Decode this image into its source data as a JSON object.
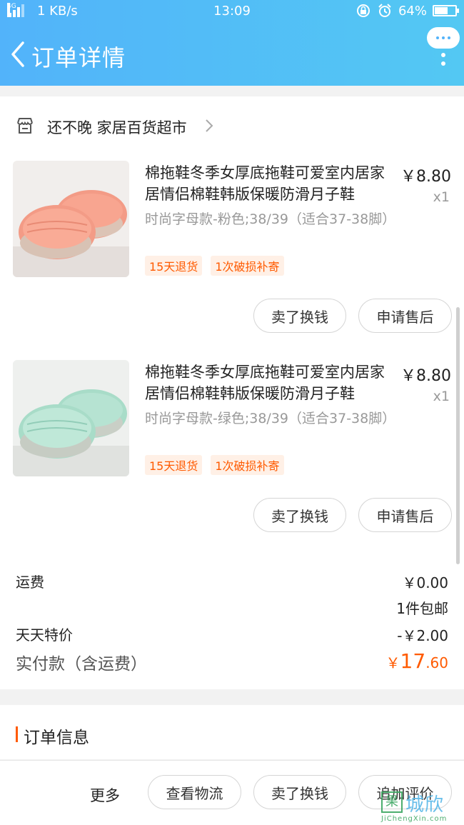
{
  "statusbar": {
    "network": "4G",
    "speed": "1 KB/s",
    "time": "13:09",
    "battery": "64%",
    "battery_level": 0.64
  },
  "nav": {
    "title": "订单详情"
  },
  "shop": {
    "name": "还不晚 家居百货超市"
  },
  "items": [
    {
      "title": "棉拖鞋冬季女厚底拖鞋可爱室内居家居情侣棉鞋韩版保暖防滑月子鞋",
      "price": "￥8.80",
      "qty": "x1",
      "spec": "时尚字母款-粉色;38/39（适合37-38脚）",
      "tags": [
        "15天退货",
        "1次破损补寄"
      ],
      "btn_sell": "卖了换钱",
      "btn_after": "申请售后",
      "color": "#f8a590"
    },
    {
      "title": "棉拖鞋冬季女厚底拖鞋可爱室内居家居情侣棉鞋韩版保暖防滑月子鞋",
      "price": "￥8.80",
      "qty": "x1",
      "spec": "时尚字母款-绿色;38/39（适合37-38脚）",
      "tags": [
        "15天退货",
        "1次破损补寄"
      ],
      "btn_sell": "卖了换钱",
      "btn_after": "申请售后",
      "color": "#b6e3d2"
    }
  ],
  "fees": {
    "shipping_label": "运费",
    "shipping_value": "￥0.00",
    "shipping_note": "1件包邮",
    "discount_label": "天天特价",
    "discount_value": "-￥2.00",
    "total_label": "实付款（含运费）",
    "total_currency": "￥",
    "total_int": "17",
    "total_dec": ".60"
  },
  "order_info": {
    "title": "订单信息"
  },
  "bottom": {
    "more": "更多",
    "btn_logistics": "查看物流",
    "btn_sell": "卖了换钱",
    "btn_review": "追加评价"
  },
  "watermark": {
    "box": "果",
    "text": "城欣",
    "sub": "JiChengXin.com"
  },
  "colors": {
    "accent": "#ff5a00",
    "header": "#52b3fa"
  }
}
